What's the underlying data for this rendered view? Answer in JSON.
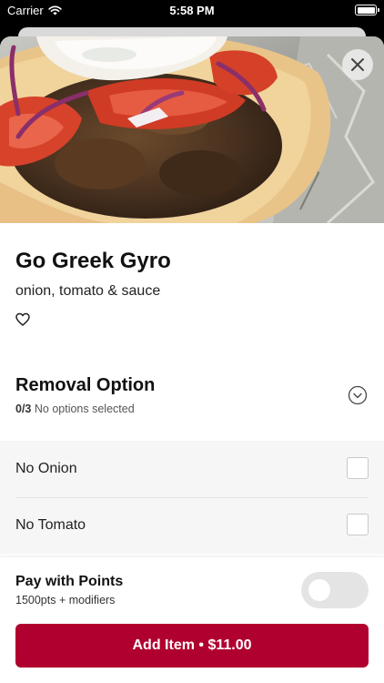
{
  "status_bar": {
    "carrier": "Carrier",
    "time": "5:58 PM"
  },
  "item": {
    "title": "Go Greek Gyro",
    "description": "onion, tomato & sauce"
  },
  "removal_option": {
    "title": "Removal Option",
    "count": "0/3",
    "status": "No options selected",
    "options": [
      {
        "label": "No Onion",
        "checked": false
      },
      {
        "label": "No Tomato",
        "checked": false
      }
    ]
  },
  "footer": {
    "points_title": "Pay with Points",
    "points_subtitle": "1500pts + modifiers",
    "points_enabled": false,
    "add_button_label": "Add Item • $11.00"
  },
  "colors": {
    "accent": "#b0002f",
    "toggle_off": "#e4e4e4"
  },
  "icons": [
    "wifi-icon",
    "battery-icon",
    "close-icon",
    "heart-icon",
    "chevron-down-icon",
    "checkbox-icon"
  ]
}
